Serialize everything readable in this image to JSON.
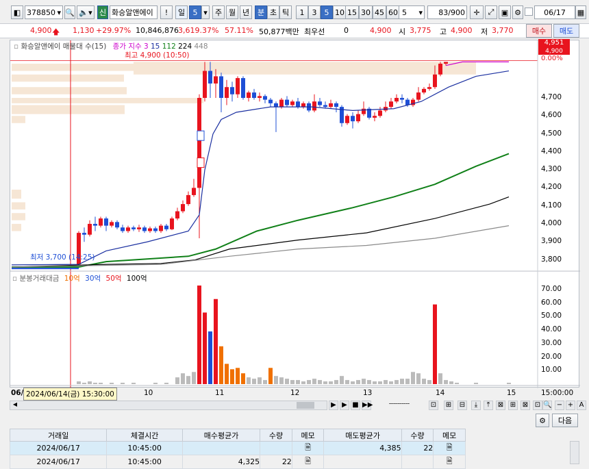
{
  "toolbar": {
    "code": "378850",
    "lock_label": "신",
    "name": "화승알앤에이",
    "alert": "!",
    "period": "일",
    "period_num": "5",
    "tabs": [
      "주",
      "월",
      "년",
      "분",
      "초",
      "틱"
    ],
    "intervals": [
      "1",
      "3",
      "5",
      "10",
      "15",
      "30",
      "45",
      "60"
    ],
    "count_sel": "5",
    "page": "83/900",
    "date": "06/17"
  },
  "info": {
    "price": "4,900",
    "change": "1,130",
    "rate": "+29.97%",
    "volume": "10,846,876",
    "vol_rate": "3,619.37%",
    "ratio": "57.11%",
    "amount": "50,877백만",
    "pref_label": "최우선",
    "pref": "0",
    "ask": "4,900",
    "open_label": "시",
    "open": "3,775",
    "high_label": "고",
    "high": "4,900",
    "low_label": "저",
    "low": "3,770",
    "buy": "매수",
    "sell": "매도"
  },
  "legend": {
    "name": "화승알앤에이 매물대 수(15)",
    "ma_label": "종가 지수 3",
    "ma1": "15",
    "ma2": "112",
    "ma3": "224",
    "ma4": "448"
  },
  "annot": {
    "high": "최고 4,900 (10:50)",
    "low": "최저 3,700 (14:25)",
    "sell_mark": "S",
    "buy_mark": "B"
  },
  "price_axis": {
    "current": "4,951",
    "current2": "4,900",
    "pct": "0.00%",
    "ticks": [
      "4,700",
      "4,600",
      "4,500",
      "4,400",
      "4,300",
      "4,200",
      "4,100",
      "4,000",
      "3,900",
      "3,800"
    ]
  },
  "vol_legend": {
    "name": "분봉거래대금",
    "l1": "10억",
    "l2": "30억",
    "l3": "50억",
    "l4": "100억"
  },
  "vol_axis": {
    "ticks": [
      "70.00",
      "60.00",
      "50.00",
      "40.00",
      "30.00",
      "20.00",
      "10.00"
    ]
  },
  "x_axis": {
    "month": "06/",
    "cursor": "2024/06/14(금) 15:30:00",
    "labels": [
      "10",
      "11",
      "12",
      "13",
      "14",
      "15"
    ],
    "time": "15:00:00"
  },
  "colors": {
    "up": "#e8141e",
    "down": "#1e4fd6",
    "ma5": "#cc00cc",
    "ma15": "#1a2fa0",
    "ma112": "#108018",
    "ma224": "#000000",
    "ma448": "#8a8a8a"
  },
  "bottom": {
    "next": "다음"
  },
  "table": {
    "headers": [
      "거래일",
      "체결시간",
      "매수평균가",
      "수량",
      "메모",
      "매도평균가",
      "수량",
      "메모"
    ],
    "rows": [
      [
        "2024/06/17",
        "10:45:00",
        "",
        "",
        "",
        "4,385",
        "22",
        ""
      ],
      [
        "2024/06/17",
        "10:45:00",
        "4,325",
        "22",
        "",
        "",
        "",
        ""
      ]
    ]
  }
}
